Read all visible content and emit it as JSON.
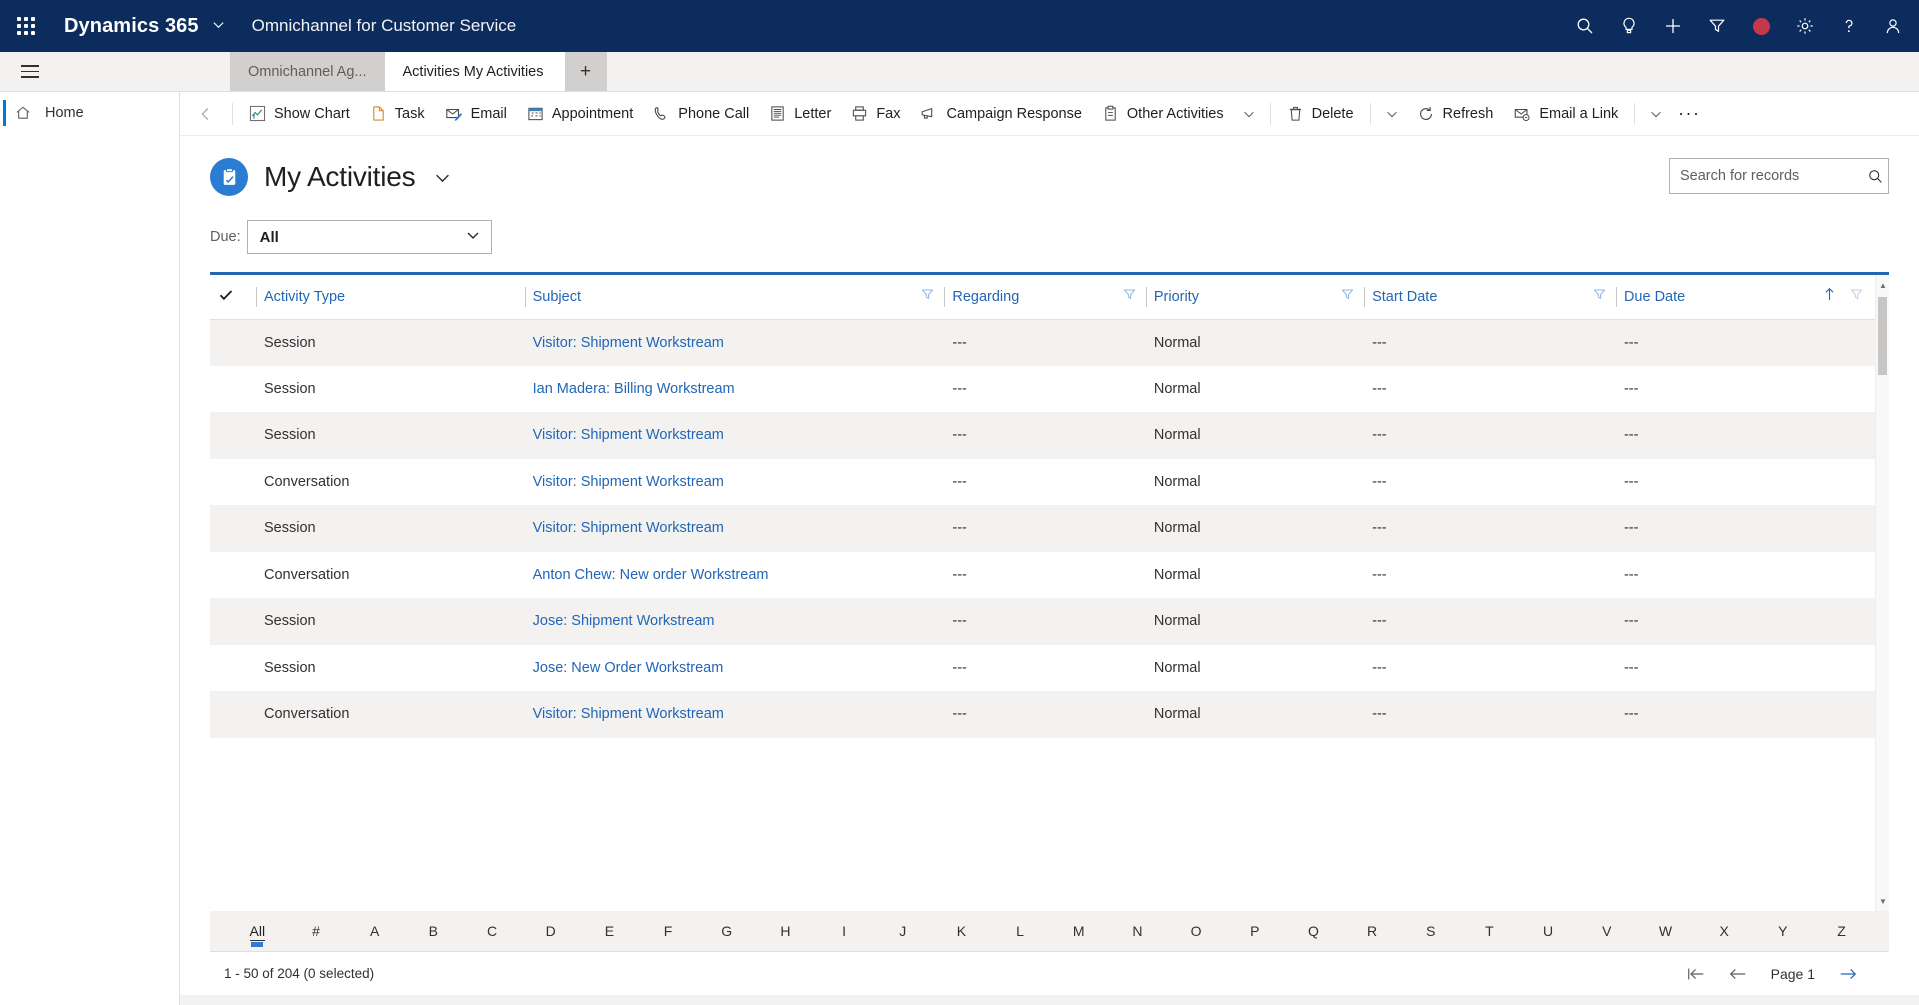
{
  "topnav": {
    "waffle_label": "app-launcher",
    "brand": "Dynamics 365",
    "app_name": "Omnichannel for Customer Service",
    "icons": [
      {
        "name": "search-icon",
        "label": "Search"
      },
      {
        "name": "lightbulb-icon",
        "label": "Assistant"
      },
      {
        "name": "plus-icon",
        "label": "Quick create"
      },
      {
        "name": "filter-icon",
        "label": "Filter"
      },
      {
        "name": "presence-dot-icon",
        "label": "Presence",
        "color": "#c4384a"
      },
      {
        "name": "gear-icon",
        "label": "Settings"
      },
      {
        "name": "help-icon",
        "label": "Help"
      },
      {
        "name": "user-icon",
        "label": "Account manager"
      }
    ]
  },
  "tabs": {
    "hamburger_label": "Site map",
    "items": [
      {
        "label": "Omnichannel Ag...",
        "active": false,
        "closable": false
      },
      {
        "label": "Activities My Activities",
        "active": true,
        "closable": true
      }
    ],
    "add_label": "+",
    "close_label": "✕"
  },
  "sidebar": {
    "items": [
      {
        "label": "Home",
        "icon": "home-icon",
        "selected": true
      }
    ]
  },
  "commandbar": {
    "back_label": "Back",
    "buttons": [
      {
        "label": "Show Chart",
        "icon": "chart-icon"
      },
      {
        "label": "Task",
        "icon": "task-icon"
      },
      {
        "label": "Email",
        "icon": "email-icon"
      },
      {
        "label": "Appointment",
        "icon": "calendar-icon"
      },
      {
        "label": "Phone Call",
        "icon": "phone-icon"
      },
      {
        "label": "Letter",
        "icon": "letter-icon"
      },
      {
        "label": "Fax",
        "icon": "fax-icon"
      },
      {
        "label": "Campaign Response",
        "icon": "campaign-icon"
      },
      {
        "label": "Other Activities",
        "icon": "other-activities-icon",
        "has_chevron": true
      },
      {
        "label": "Delete",
        "icon": "delete-icon",
        "separator_before": true,
        "chevron_after": true
      },
      {
        "label": "Refresh",
        "icon": "refresh-icon"
      },
      {
        "label": "Email a Link",
        "icon": "email-link-icon",
        "separator_after": true,
        "chevron_after": true
      }
    ],
    "overflow_label": "···"
  },
  "page": {
    "title": "My Activities",
    "title_icon": "activities-icon",
    "title_chevron": "chevron-down-icon",
    "search_placeholder": "Search for records",
    "search_value": "",
    "filter_label": "Due:",
    "filter_value": "All"
  },
  "grid": {
    "columns": [
      {
        "label": "",
        "key": "check",
        "type": "check"
      },
      {
        "label": "Activity Type",
        "key": "activity_type",
        "filter": false,
        "width": "16%"
      },
      {
        "label": "Subject",
        "key": "subject",
        "filter": true,
        "width": "25%"
      },
      {
        "label": "Regarding",
        "key": "regarding",
        "filter": true,
        "width": "13%"
      },
      {
        "label": "Priority",
        "key": "priority",
        "filter": true,
        "width": "13%"
      },
      {
        "label": "Start Date",
        "key": "start_date",
        "filter": true,
        "width": "16%"
      },
      {
        "label": "Due Date",
        "key": "due_date",
        "filter": true,
        "sorted": "asc",
        "width": "17%"
      }
    ],
    "rows": [
      {
        "activity_type": "Session",
        "subject": "Visitor: Shipment Workstream",
        "regarding": "---",
        "priority": "Normal",
        "start_date": "---",
        "due_date": "---"
      },
      {
        "activity_type": "Session",
        "subject": "Ian Madera: Billing Workstream",
        "regarding": "---",
        "priority": "Normal",
        "start_date": "---",
        "due_date": "---"
      },
      {
        "activity_type": "Session",
        "subject": "Visitor: Shipment Workstream",
        "regarding": "---",
        "priority": "Normal",
        "start_date": "---",
        "due_date": "---"
      },
      {
        "activity_type": "Conversation",
        "subject": "Visitor: Shipment Workstream",
        "regarding": "---",
        "priority": "Normal",
        "start_date": "---",
        "due_date": "---"
      },
      {
        "activity_type": "Session",
        "subject": "Visitor: Shipment Workstream",
        "regarding": "---",
        "priority": "Normal",
        "start_date": "---",
        "due_date": "---"
      },
      {
        "activity_type": "Conversation",
        "subject": "Anton Chew: New order Workstream",
        "regarding": "---",
        "priority": "Normal",
        "start_date": "---",
        "due_date": "---"
      },
      {
        "activity_type": "Session",
        "subject": "Jose: Shipment Workstream",
        "regarding": "---",
        "priority": "Normal",
        "start_date": "---",
        "due_date": "---"
      },
      {
        "activity_type": "Session",
        "subject": "Jose: New Order Workstream",
        "regarding": "---",
        "priority": "Normal",
        "start_date": "---",
        "due_date": "---"
      },
      {
        "activity_type": "Conversation",
        "subject": "Visitor: Shipment Workstream",
        "regarding": "---",
        "priority": "Normal",
        "start_date": "---",
        "due_date": "---"
      }
    ]
  },
  "alphabar": {
    "selected": "All",
    "letters": [
      "All",
      "#",
      "A",
      "B",
      "C",
      "D",
      "E",
      "F",
      "G",
      "H",
      "I",
      "J",
      "K",
      "L",
      "M",
      "N",
      "O",
      "P",
      "Q",
      "R",
      "S",
      "T",
      "U",
      "V",
      "W",
      "X",
      "Y",
      "Z"
    ]
  },
  "footer": {
    "record_count": "1 - 50 of 204 (0 selected)",
    "page_label": "Page 1",
    "first_label": "first-page",
    "prev_label": "previous-page",
    "next_label": "next-page"
  },
  "colors": {
    "navy": "#0b2c5d",
    "accent_blue": "#2266b5",
    "link_blue": "#2266b5",
    "badge_blue": "#2b7cd3",
    "presence_red": "#c4384a",
    "row_alt": "#f3f2f1"
  }
}
